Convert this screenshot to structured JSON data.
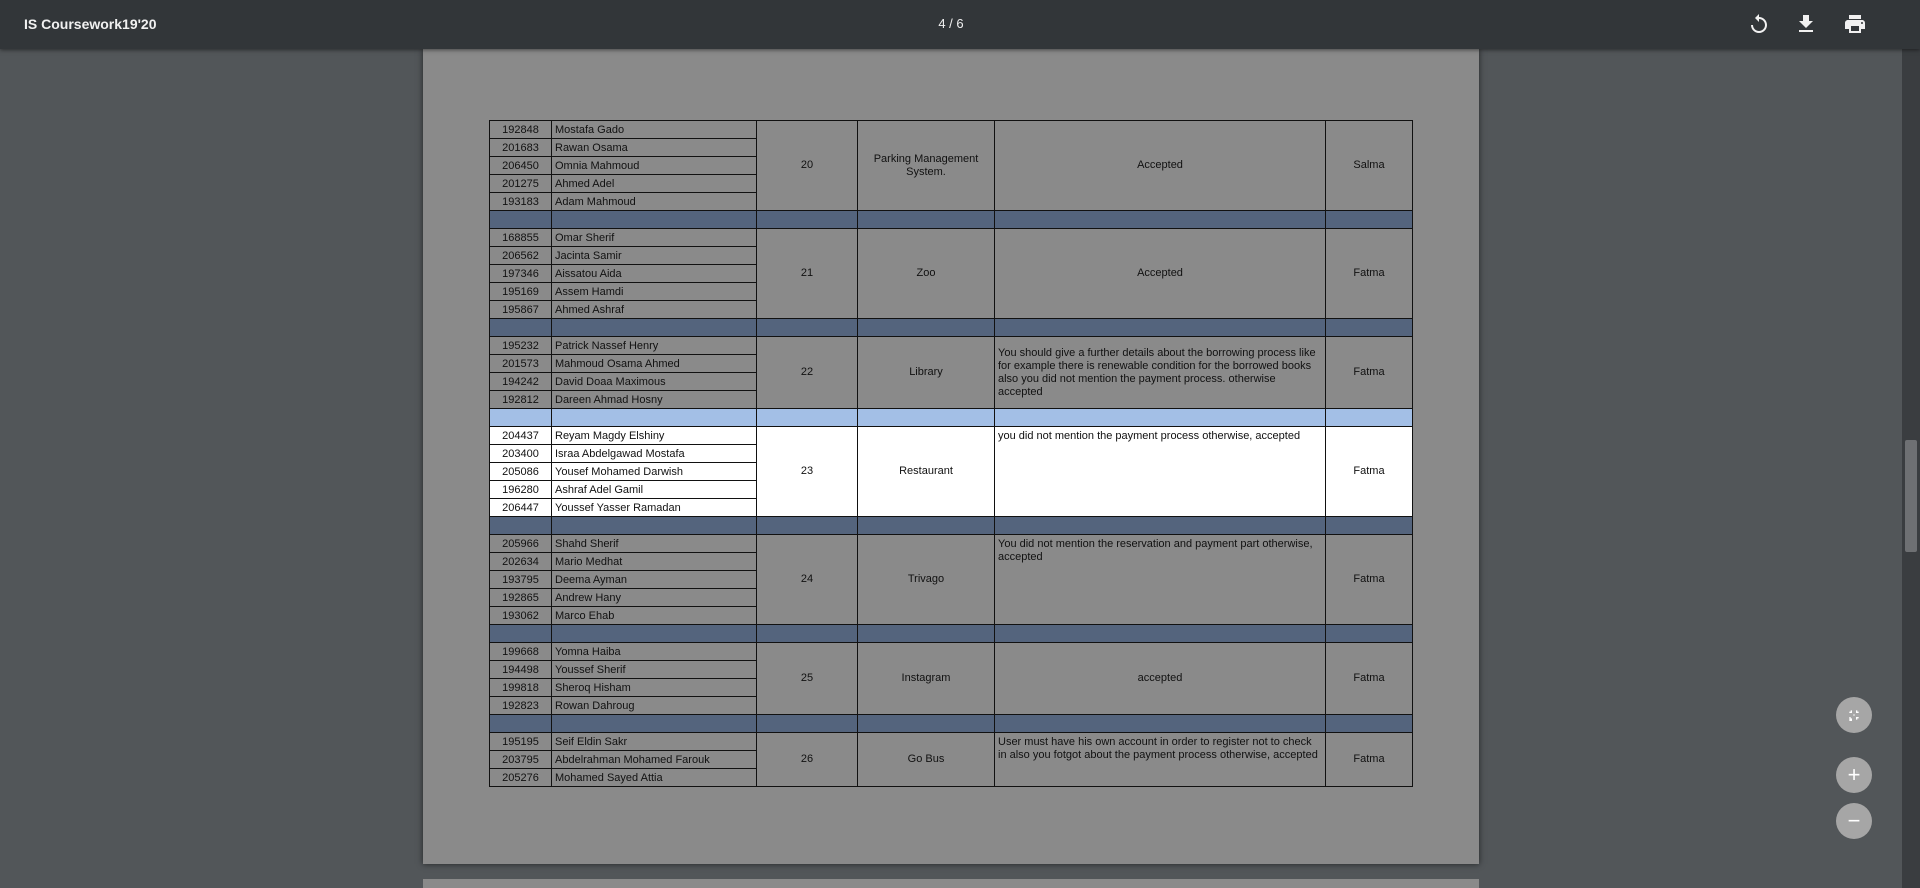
{
  "toolbar": {
    "title": "IS Coursework19'20",
    "page_indicator": "4 / 6",
    "icons": [
      "rotate-icon",
      "download-icon",
      "print-icon"
    ]
  },
  "groups": [
    {
      "members": [
        {
          "id": "192848",
          "name": "Mostafa Gado"
        },
        {
          "id": "201683",
          "name": "Rawan Osama"
        },
        {
          "id": "206450",
          "name": "Omnia Mahmoud"
        },
        {
          "id": "201275",
          "name": "Ahmed Adel"
        },
        {
          "id": "193183",
          "name": "Adam Mahmoud"
        }
      ],
      "number": "20",
      "project": "Parking Management System.",
      "feedback": "Accepted",
      "grader": "Salma"
    },
    {
      "members": [
        {
          "id": "168855",
          "name": "Omar Sherif"
        },
        {
          "id": "206562",
          "name": "Jacinta Samir"
        },
        {
          "id": "197346",
          "name": "Aissatou Aida"
        },
        {
          "id": "195169",
          "name": "Assem Hamdi"
        },
        {
          "id": "195867",
          "name": "Ahmed Ashraf"
        }
      ],
      "number": "21",
      "project": "Zoo",
      "feedback": "Accepted",
      "grader": "Fatma"
    },
    {
      "members": [
        {
          "id": "195232",
          "name": "Patrick Nassef Henry"
        },
        {
          "id": "201573",
          "name": "Mahmoud Osama Ahmed"
        },
        {
          "id": "194242",
          "name": "David Doaa Maximous"
        },
        {
          "id": "192812",
          "name": "Dareen Ahmad Hosny"
        }
      ],
      "number": "22",
      "project": "Library",
      "feedback": " You should give a further details about the borrowing process like for example there is renewable condition for the borrowed books also you did not mention the payment process. otherwise accepted",
      "grader": "Fatma"
    },
    {
      "members": [
        {
          "id": "204437",
          "name": "Reyam Magdy Elshiny"
        },
        {
          "id": "203400",
          "name": "Israa Abdelgawad Mostafa"
        },
        {
          "id": "205086",
          "name": "Yousef Mohamed Darwish"
        },
        {
          "id": "196280",
          "name": "Ashraf Adel Gamil"
        },
        {
          "id": "206447",
          "name": "Youssef Yasser Ramadan"
        }
      ],
      "number": "23",
      "project": "Restaurant",
      "feedback": "you did not mention the payment process otherwise, accepted",
      "grader": "Fatma"
    },
    {
      "members": [
        {
          "id": "205966",
          "name": "Shahd Sherif"
        },
        {
          "id": "202634",
          "name": "Mario Medhat"
        },
        {
          "id": "193795",
          "name": "Deema Ayman"
        },
        {
          "id": "192865",
          "name": "Andrew Hany"
        },
        {
          "id": "193062",
          "name": "Marco Ehab"
        }
      ],
      "number": "24",
      "project": "Trivago",
      "feedback": "You did not mention the reservation and payment part otherwise, accepted",
      "grader": "Fatma"
    },
    {
      "members": [
        {
          "id": "199668",
          "name": "Yomna Haiba"
        },
        {
          "id": "194498",
          "name": "Youssef Sherif"
        },
        {
          "id": "199818",
          "name": "Sheroq Hisham"
        },
        {
          "id": "192823",
          "name": "Rowan Dahroug"
        }
      ],
      "number": "25",
      "project": "Instagram",
      "feedback": "accepted",
      "grader": "Fatma"
    },
    {
      "members": [
        {
          "id": "195195",
          "name": "Seif Eldin Sakr"
        },
        {
          "id": "203795",
          "name": "Abdelrahman Mohamed Farouk"
        },
        {
          "id": "205276",
          "name": "Mohamed Sayed Attia"
        }
      ],
      "number": "26",
      "project": "Go Bus",
      "feedback": "User must have his own account in order to  register not to check in also you fotgot about the payment process otherwise, accepted",
      "grader": "Fatma"
    }
  ],
  "controls": {
    "fit_icon": "fit-to-page-icon",
    "zoom_in_label": "+",
    "zoom_out_label": "−"
  },
  "colors": {
    "separator": "#54647d",
    "separator_highlight": "#a3bfe6",
    "toolbar": "#323639"
  }
}
